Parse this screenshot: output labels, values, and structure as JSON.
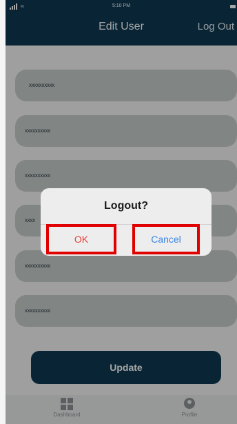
{
  "status_bar": {
    "time": "5:10 PM"
  },
  "header": {
    "title": "Edit User",
    "logout_label": "Log Out"
  },
  "fields": [
    {
      "value": "xxxxxxxxxx"
    },
    {
      "value": "xxxxxxxxxx"
    },
    {
      "value": "xxxxxxxxxx"
    },
    {
      "value": "xxxx"
    },
    {
      "value": "xxxxxxxxxx"
    },
    {
      "value": "xxxxxxxxxx"
    }
  ],
  "update_label": "Update",
  "bottom_nav": {
    "items": [
      {
        "label": "Dashboard",
        "icon": "dashboard-icon"
      },
      {
        "label": "Profile",
        "icon": "profile-icon"
      }
    ]
  },
  "dialog": {
    "title": "Logout?",
    "ok_label": "OK",
    "cancel_label": "Cancel"
  },
  "colors": {
    "header": "#0f3a52",
    "ok": "#e5423a",
    "cancel": "#3a85e6",
    "highlight": "#e00000"
  }
}
